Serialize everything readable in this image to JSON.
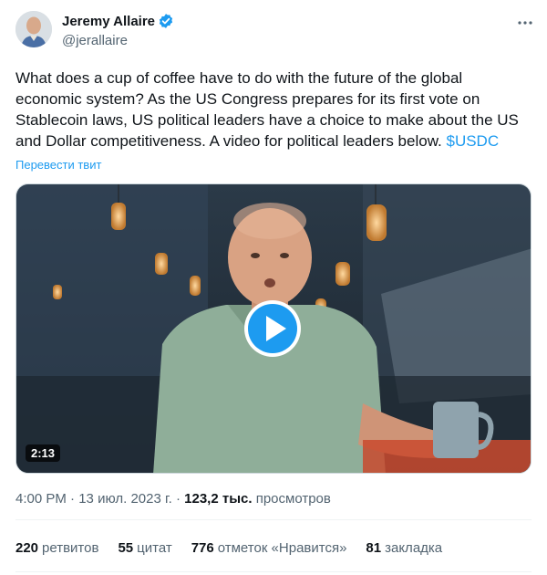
{
  "author": {
    "name": "Jeremy Allaire",
    "handle": "@jerallaire"
  },
  "tweet": {
    "text": "What does a cup of coffee have to do with the future of the global economic system?  As the US Congress prepares for its first vote on Stablecoin laws, US political leaders have a choice to make about the US and Dollar competitiveness.  A video for political leaders below. ",
    "cashtag": "$USDC",
    "translate_label": "Перевести твит"
  },
  "media": {
    "duration": "2:13"
  },
  "meta": {
    "time": "4:00 PM",
    "separator": " · ",
    "date": "13 июл. 2023 г.",
    "views_count": "123,2 тыс.",
    "views_label": "просмотров"
  },
  "stats": [
    {
      "count": "220",
      "label": "ретвитов"
    },
    {
      "count": "55",
      "label": "цитат"
    },
    {
      "count": "776",
      "label": "отметок «Нравится»"
    },
    {
      "count": "81",
      "label": "закладка"
    }
  ],
  "icons": {
    "verified": "verified-badge-icon",
    "more": "more-horizontal-icon",
    "play": "play-icon"
  },
  "colors": {
    "accent": "#1d9bf0",
    "text": "#0f1419",
    "secondary": "#536471"
  }
}
